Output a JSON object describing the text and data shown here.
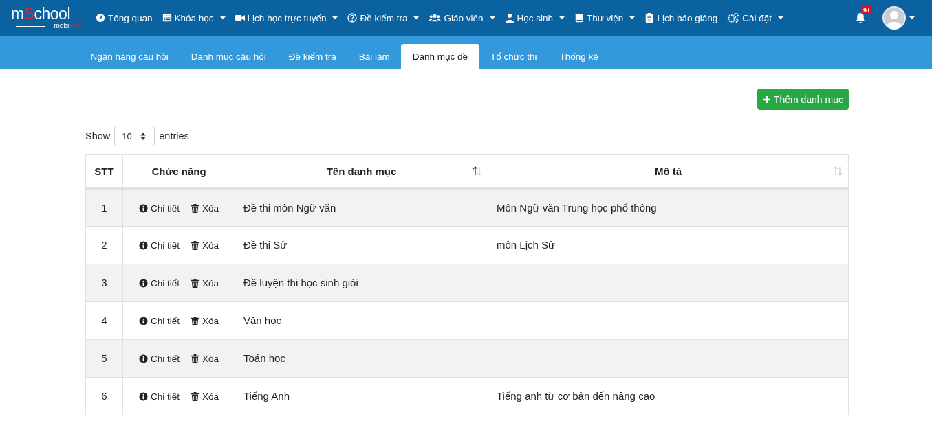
{
  "logo": {
    "prefix": "m",
    "highlight": "S",
    "suffix": "chool",
    "sub_prefix": "mobi",
    "sub_highlight": "Edu"
  },
  "nav": [
    {
      "label": "Tổng quan",
      "dropdown": false
    },
    {
      "label": "Khóa học",
      "dropdown": true
    },
    {
      "label": "Lịch học trực tuyến",
      "dropdown": true
    },
    {
      "label": "Đề kiểm tra",
      "dropdown": true
    },
    {
      "label": "Giáo viên",
      "dropdown": true
    },
    {
      "label": "Học sinh",
      "dropdown": true
    },
    {
      "label": "Thư viện",
      "dropdown": true
    },
    {
      "label": "Lịch báo giảng",
      "dropdown": false
    },
    {
      "label": "Cài đặt",
      "dropdown": true
    }
  ],
  "notifications": {
    "badge": "9+"
  },
  "tabs": [
    {
      "label": "Ngân hàng câu hỏi",
      "selected": false
    },
    {
      "label": "Danh mục câu hỏi",
      "selected": false
    },
    {
      "label": "Đề kiểm tra",
      "selected": false
    },
    {
      "label": "Bài làm",
      "selected": false
    },
    {
      "label": "Danh mục đề",
      "selected": true
    },
    {
      "label": "Tổ chức thi",
      "selected": false
    },
    {
      "label": "Thống kê",
      "selected": false
    }
  ],
  "add_button": "Thêm danh mục",
  "length": {
    "before": "Show",
    "value": "10",
    "after": "entries"
  },
  "table": {
    "columns": [
      {
        "label": "STT",
        "sortable": false
      },
      {
        "label": "Chức năng",
        "sortable": false
      },
      {
        "label": "Tên danh mục",
        "sortable": true,
        "sorted": true
      },
      {
        "label": "Mô tả",
        "sortable": true,
        "sorted": false
      }
    ],
    "rows": [
      {
        "stt": "1",
        "detail": "Chi tiết",
        "delete": "Xóa",
        "name": "Đề thi môn Ngữ văn",
        "description": "Môn Ngữ văn Trung học phổ thông"
      },
      {
        "stt": "2",
        "detail": "Chi tiết",
        "delete": "Xóa",
        "name": "Đề thi Sử",
        "description": "môn Lịch Sử"
      },
      {
        "stt": "3",
        "detail": "Chi tiết",
        "delete": "Xóa",
        "name": "Đề luyện thi học sinh giỏi"
      },
      {
        "stt": "4",
        "detail": "Chi tiết",
        "delete": "Xóa",
        "name": "Văn học"
      },
      {
        "stt": "5",
        "detail": "Chi tiết",
        "delete": "Xóa",
        "name": "Toán học"
      },
      {
        "stt": "6",
        "detail": "Chi tiết",
        "delete": "Xóa",
        "name": "Tiếng Anh",
        "description": "Tiếng anh từ cơ bản đến nâng cao"
      }
    ]
  }
}
